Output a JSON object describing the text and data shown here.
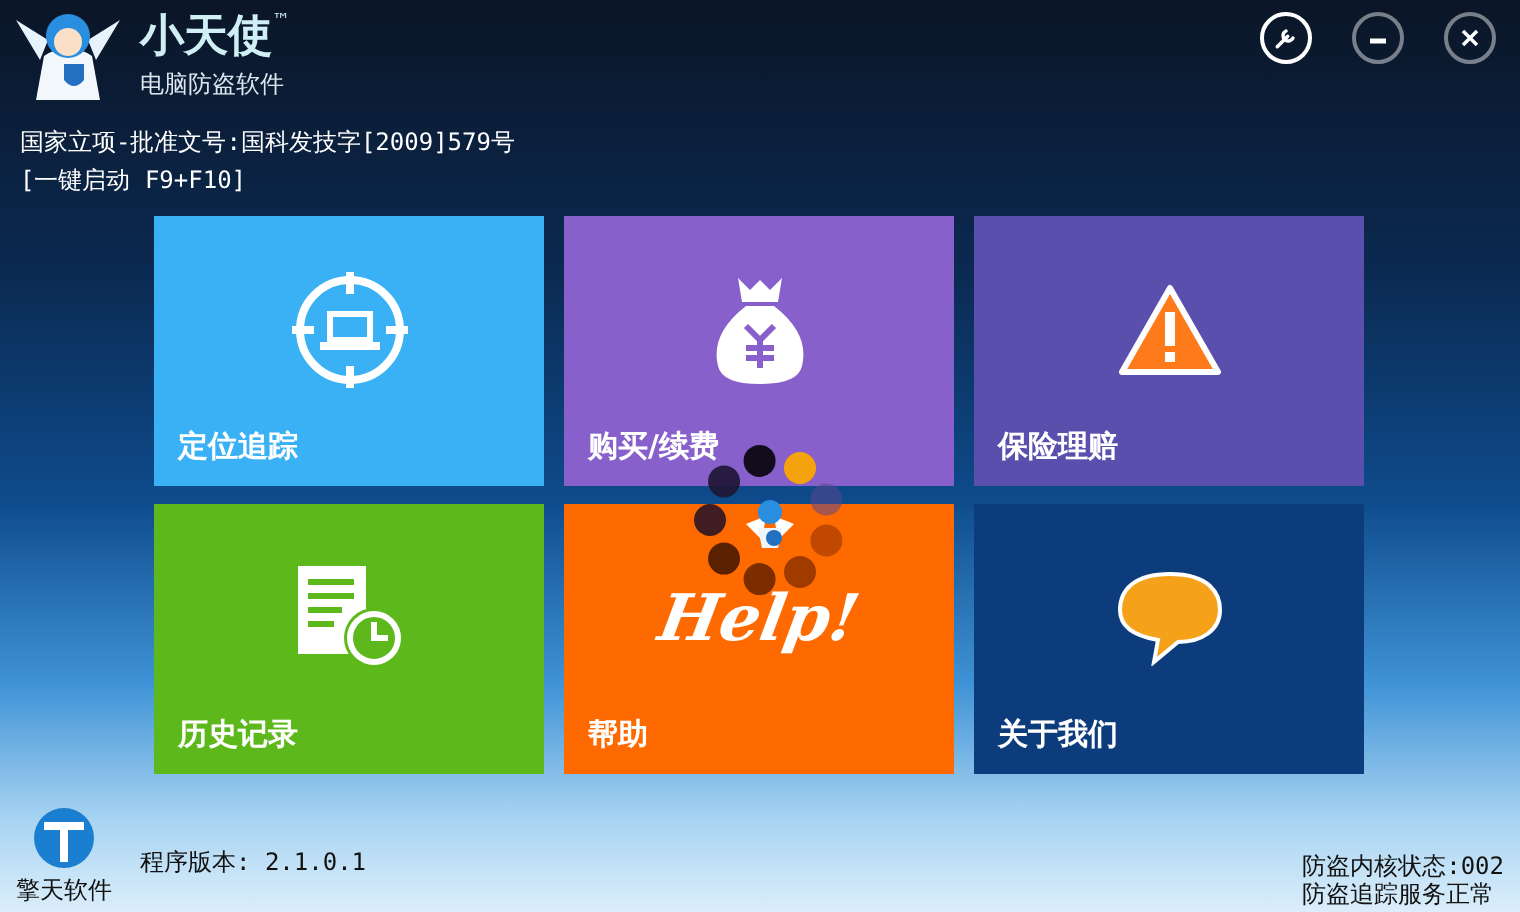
{
  "app": {
    "name": "小天使",
    "trademark": "™",
    "subtitle": "电脑防盗软件"
  },
  "window_controls": [
    {
      "kind": "settings"
    },
    {
      "kind": "minimize"
    },
    {
      "kind": "close"
    }
  ],
  "info_lines": [
    "国家立项-批准文号:国科发技字[2009]579号",
    "[一键启动 F9+F10]"
  ],
  "tiles": [
    {
      "label": "定位追踪",
      "kind": "locate",
      "color": "#3ab1f4"
    },
    {
      "label": "购买/续费",
      "kind": "money",
      "color": "#8860cb"
    },
    {
      "label": "保险理赔",
      "kind": "warning",
      "color": "#5b4fae"
    },
    {
      "label": "历史记录",
      "kind": "history",
      "color": "#5db81b"
    },
    {
      "label": "帮助",
      "kind": "help",
      "color": "#ff6a00",
      "art_text": "Help!"
    },
    {
      "label": "关于我们",
      "kind": "chat",
      "color": "#0d3c7c"
    }
  ],
  "footer": {
    "company": "擎天软件",
    "version": "程序版本: 2.1.0.1",
    "status_lines": [
      "防盗内核状态:002",
      "防盗追踪服务正常"
    ]
  }
}
